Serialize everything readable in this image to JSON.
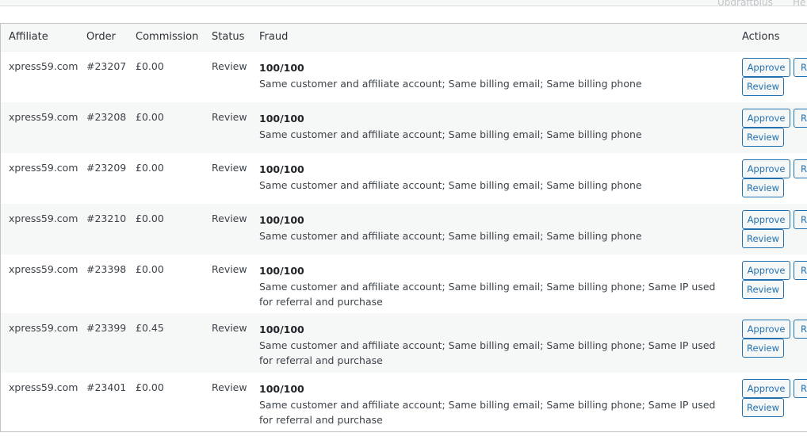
{
  "topbar": {
    "items": [
      "Updraftplus",
      "He"
    ]
  },
  "table": {
    "headers": {
      "affiliate": "Affiliate",
      "order": "Order",
      "commission": "Commission",
      "status": "Status",
      "fraud": "Fraud",
      "actions": "Actions"
    },
    "buttons": {
      "approve": "Approve",
      "reject": "Re",
      "review": "Review"
    },
    "rows": [
      {
        "affiliate": "xpress59.com",
        "order": "#23207",
        "commission": "£0.00",
        "status": "Review",
        "score": "100/100",
        "reasons": "Same customer and affiliate account; Same billing email; Same billing phone"
      },
      {
        "affiliate": "xpress59.com",
        "order": "#23208",
        "commission": "£0.00",
        "status": "Review",
        "score": "100/100",
        "reasons": "Same customer and affiliate account; Same billing email; Same billing phone"
      },
      {
        "affiliate": "xpress59.com",
        "order": "#23209",
        "commission": "£0.00",
        "status": "Review",
        "score": "100/100",
        "reasons": "Same customer and affiliate account; Same billing email; Same billing phone"
      },
      {
        "affiliate": "xpress59.com",
        "order": "#23210",
        "commission": "£0.00",
        "status": "Review",
        "score": "100/100",
        "reasons": "Same customer and affiliate account; Same billing email; Same billing phone"
      },
      {
        "affiliate": "xpress59.com",
        "order": "#23398",
        "commission": "£0.00",
        "status": "Review",
        "score": "100/100",
        "reasons": "Same customer and affiliate account; Same billing email; Same billing phone; Same IP used for referral and purchase"
      },
      {
        "affiliate": "xpress59.com",
        "order": "#23399",
        "commission": "£0.45",
        "status": "Review",
        "score": "100/100",
        "reasons": "Same customer and affiliate account; Same billing email; Same billing phone; Same IP used for referral and purchase"
      },
      {
        "affiliate": "xpress59.com",
        "order": "#23401",
        "commission": "£0.00",
        "status": "Review",
        "score": "100/100",
        "reasons": "Same customer and affiliate account; Same billing email; Same billing phone; Same IP used for referral and purchase"
      }
    ]
  }
}
